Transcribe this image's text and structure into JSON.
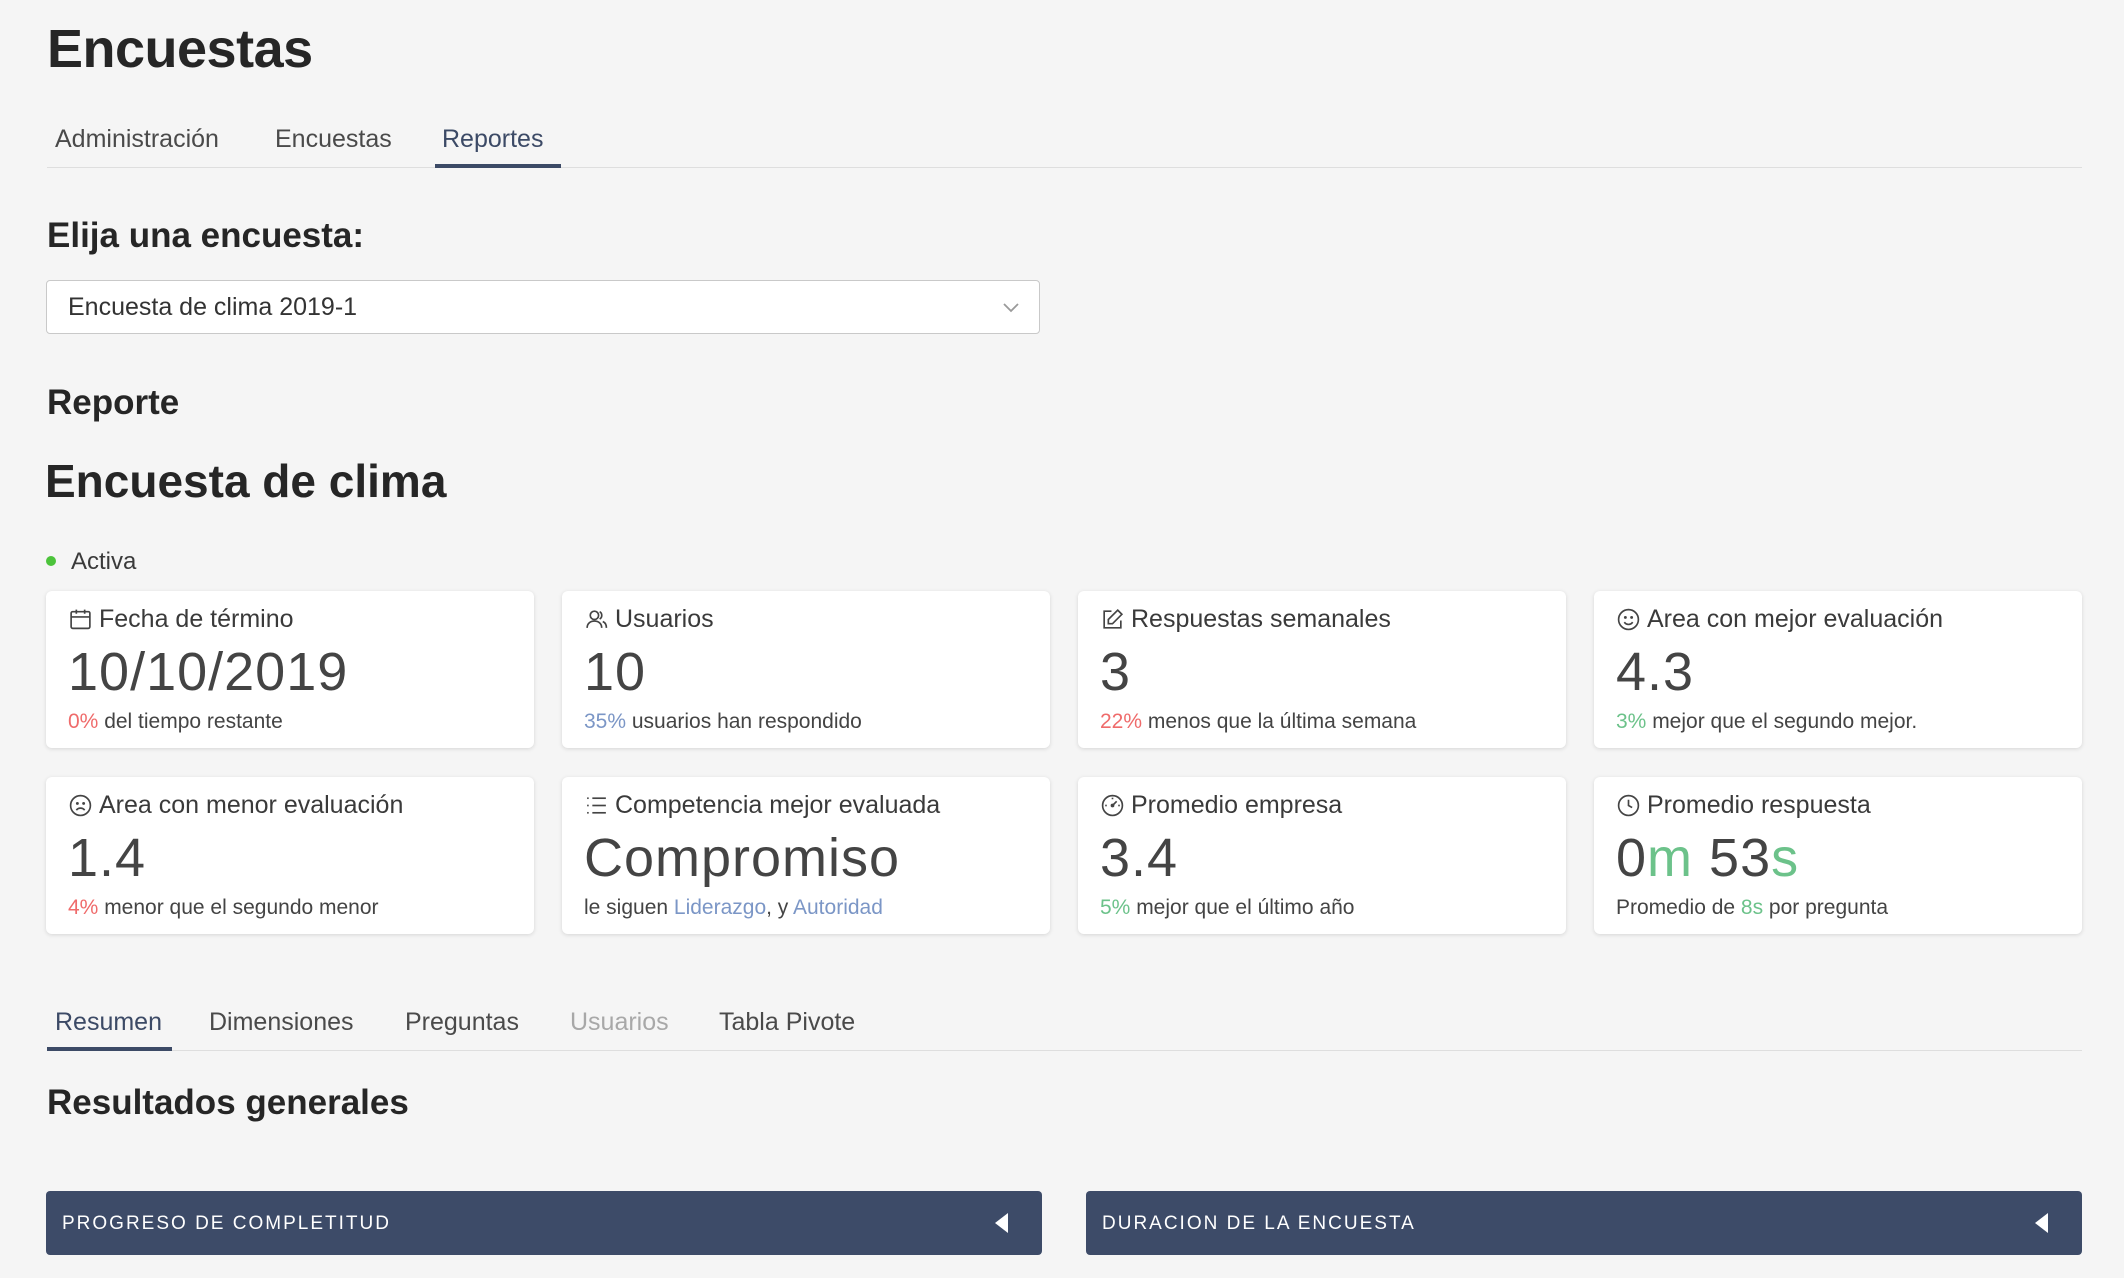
{
  "page": {
    "title": "Encuestas"
  },
  "top_tabs": [
    {
      "label": "Administración",
      "active": false
    },
    {
      "label": "Encuestas",
      "active": false
    },
    {
      "label": "Reportes",
      "active": true
    }
  ],
  "survey_select": {
    "label": "Elija una encuesta:",
    "selected": "Encuesta de clima 2019-1"
  },
  "report": {
    "section_label": "Reporte",
    "survey_name": "Encuesta de clima",
    "status": "Activa",
    "status_color": "#4cc33b"
  },
  "cards": [
    {
      "icon": "calendar-icon",
      "title": "Fecha de término",
      "value": "10/10/2019",
      "foot_highlight": "0%",
      "foot_text": " del tiempo restante"
    },
    {
      "icon": "users-icon",
      "title": "Usuarios",
      "value": "10",
      "foot_highlight": "35%",
      "foot_text": " usuarios han respondido"
    },
    {
      "icon": "edit-icon",
      "title": "Respuestas semanales",
      "value": "3",
      "foot_highlight": "22%",
      "foot_text": " menos que la última semana"
    },
    {
      "icon": "smile-icon",
      "title": "Area con mejor evaluación",
      "value": "4.3",
      "foot_highlight": "3%",
      "foot_text": " mejor que el segundo mejor."
    },
    {
      "icon": "frown-icon",
      "title": "Area con menor evaluación",
      "value": "1.4",
      "foot_highlight": "4%",
      "foot_text": " menor que el segundo menor"
    },
    {
      "icon": "list-icon",
      "title": "Competencia mejor evaluada",
      "value": "Compromiso",
      "foot_prefix": "le siguen ",
      "foot_link1": "Liderazgo",
      "foot_sep": ", y ",
      "foot_link2": "Autoridad"
    },
    {
      "icon": "dashboard-icon",
      "title": "Promedio empresa",
      "value": "3.4",
      "foot_highlight": "5%",
      "foot_text": " mejor que el último año"
    },
    {
      "icon": "clock-icon",
      "title": "Promedio respuesta",
      "value_min": "0",
      "value_min_unit": "m",
      "value_sec": " 53",
      "value_sec_unit": "s",
      "foot_prefix": "Promedio de ",
      "foot_highlight": "8s",
      "foot_text": " por pregunta"
    }
  ],
  "report_tabs": [
    {
      "label": "Resumen",
      "active": true,
      "disabled": false
    },
    {
      "label": "Dimensiones",
      "active": false,
      "disabled": false
    },
    {
      "label": "Preguntas",
      "active": false,
      "disabled": false
    },
    {
      "label": "Usuarios",
      "active": false,
      "disabled": true
    },
    {
      "label": "Tabla Pivote",
      "active": false,
      "disabled": false
    }
  ],
  "results": {
    "heading": "Resultados generales",
    "panels": [
      {
        "title": "PROGRESO DE COMPLETITUD"
      },
      {
        "title": "DURACION DE LA ENCUESTA"
      }
    ]
  },
  "colors": {
    "accent": "#3d4b68",
    "negative": "#ef6b6b",
    "positive": "#6cc28a",
    "link": "#7b96c6"
  }
}
